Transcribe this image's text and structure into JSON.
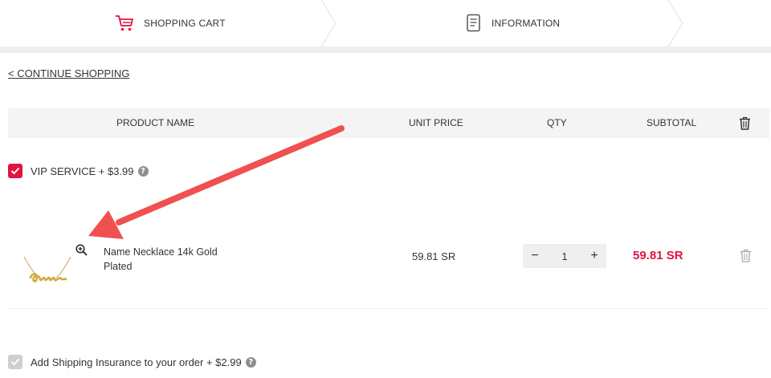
{
  "steps": [
    {
      "label": "SHOPPING CART",
      "icon": "cart-icon",
      "active": true
    },
    {
      "label": "INFORMATION",
      "icon": "document-icon",
      "active": false
    }
  ],
  "continue_shopping": "< CONTINUE SHOPPING",
  "table": {
    "headers": {
      "product_name": "PRODUCT NAME",
      "unit_price": "UNIT PRICE",
      "qty": "QTY",
      "subtotal": "SUBTOTAL"
    },
    "delete_all_icon": "trash-icon"
  },
  "vip_service": {
    "label": "VIP SERVICE + $3.99",
    "checked": true,
    "help": "?"
  },
  "cart_items": [
    {
      "name": "Name Necklace 14k Gold Plated",
      "unit_price": "59.81 SR",
      "quantity": "1",
      "subtotal": "59.81 SR",
      "minus": "−",
      "plus": "+"
    }
  ],
  "shipping_insurance": {
    "label": "Add Shipping Insurance to your order + $2.99",
    "checked": true,
    "help": "?"
  },
  "colors": {
    "accent": "#e4123f",
    "arrow": "#f0504f",
    "header_bg": "#f4f4f4"
  }
}
